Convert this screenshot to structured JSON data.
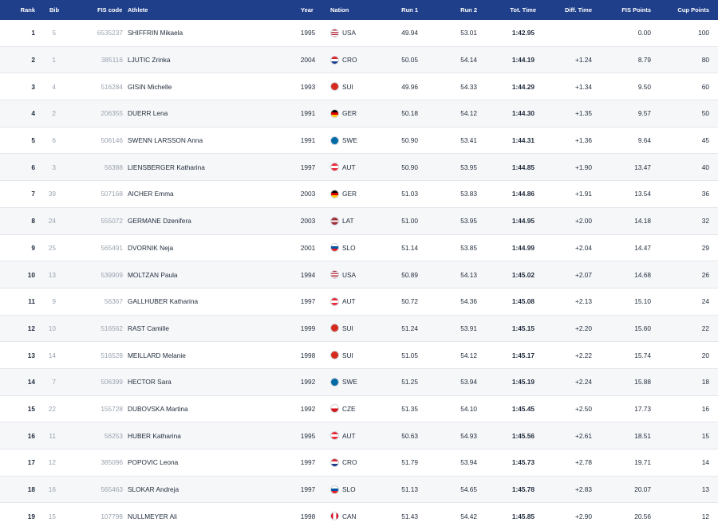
{
  "headers": {
    "rank": "Rank",
    "bib": "Bib",
    "fis_code": "FIS code",
    "athlete": "Athlete",
    "year": "Year",
    "nation": "Nation",
    "run1": "Run 1",
    "run2": "Run 2",
    "tot_time": "Tot. Time",
    "diff_time": "Diff. Time",
    "fis_points": "FIS Points",
    "cup_points": "Cup Points"
  },
  "rows": [
    {
      "rank": "1",
      "bib": "5",
      "fis_code": "6535237",
      "athlete": "SHIFFRIN Mikaela",
      "year": "1995",
      "nation": "USA",
      "flag": "flag-usa-icon",
      "run1": "49.94",
      "run2": "53.01",
      "tot_time": "1:42.95",
      "diff": "",
      "fis_points": "0.00",
      "cup_points": "100"
    },
    {
      "rank": "2",
      "bib": "1",
      "fis_code": "385116",
      "athlete": "LJUTIC Zrinka",
      "year": "2004",
      "nation": "CRO",
      "flag": "flag-cro-icon",
      "run1": "50.05",
      "run2": "54.14",
      "tot_time": "1:44.19",
      "diff": "+1.24",
      "fis_points": "8.79",
      "cup_points": "80"
    },
    {
      "rank": "3",
      "bib": "4",
      "fis_code": "516284",
      "athlete": "GISIN Michelle",
      "year": "1993",
      "nation": "SUI",
      "flag": "flag-sui-icon",
      "run1": "49.96",
      "run2": "54.33",
      "tot_time": "1:44.29",
      "diff": "+1.34",
      "fis_points": "9.50",
      "cup_points": "60"
    },
    {
      "rank": "4",
      "bib": "2",
      "fis_code": "206355",
      "athlete": "DUERR Lena",
      "year": "1991",
      "nation": "GER",
      "flag": "flag-ger-icon",
      "run1": "50.18",
      "run2": "54.12",
      "tot_time": "1:44.30",
      "diff": "+1.35",
      "fis_points": "9.57",
      "cup_points": "50"
    },
    {
      "rank": "5",
      "bib": "6",
      "fis_code": "506146",
      "athlete": "SWENN LARSSON Anna",
      "year": "1991",
      "nation": "SWE",
      "flag": "flag-swe-icon",
      "run1": "50.90",
      "run2": "53.41",
      "tot_time": "1:44.31",
      "diff": "+1.36",
      "fis_points": "9.64",
      "cup_points": "45"
    },
    {
      "rank": "6",
      "bib": "3",
      "fis_code": "56388",
      "athlete": "LIENSBERGER Katharina",
      "year": "1997",
      "nation": "AUT",
      "flag": "flag-aut-icon",
      "run1": "50.90",
      "run2": "53.95",
      "tot_time": "1:44.85",
      "diff": "+1.90",
      "fis_points": "13.47",
      "cup_points": "40"
    },
    {
      "rank": "7",
      "bib": "39",
      "fis_code": "507168",
      "athlete": "AICHER Emma",
      "year": "2003",
      "nation": "GER",
      "flag": "flag-ger-icon",
      "run1": "51.03",
      "run2": "53.83",
      "tot_time": "1:44.86",
      "diff": "+1.91",
      "fis_points": "13.54",
      "cup_points": "36"
    },
    {
      "rank": "8",
      "bib": "24",
      "fis_code": "555072",
      "athlete": "GERMANE Dzenifera",
      "year": "2003",
      "nation": "LAT",
      "flag": "flag-lat-icon",
      "run1": "51.00",
      "run2": "53.95",
      "tot_time": "1:44.95",
      "diff": "+2.00",
      "fis_points": "14.18",
      "cup_points": "32"
    },
    {
      "rank": "9",
      "bib": "25",
      "fis_code": "565491",
      "athlete": "DVORNIK Neja",
      "year": "2001",
      "nation": "SLO",
      "flag": "flag-slo-icon",
      "run1": "51.14",
      "run2": "53.85",
      "tot_time": "1:44.99",
      "diff": "+2.04",
      "fis_points": "14.47",
      "cup_points": "29"
    },
    {
      "rank": "10",
      "bib": "13",
      "fis_code": "539909",
      "athlete": "MOLTZAN Paula",
      "year": "1994",
      "nation": "USA",
      "flag": "flag-usa-icon",
      "run1": "50.89",
      "run2": "54.13",
      "tot_time": "1:45.02",
      "diff": "+2.07",
      "fis_points": "14.68",
      "cup_points": "26"
    },
    {
      "rank": "11",
      "bib": "9",
      "fis_code": "56367",
      "athlete": "GALLHUBER Katharina",
      "year": "1997",
      "nation": "AUT",
      "flag": "flag-aut-icon",
      "run1": "50.72",
      "run2": "54.36",
      "tot_time": "1:45.08",
      "diff": "+2.13",
      "fis_points": "15.10",
      "cup_points": "24"
    },
    {
      "rank": "12",
      "bib": "10",
      "fis_code": "516562",
      "athlete": "RAST Camille",
      "year": "1999",
      "nation": "SUI",
      "flag": "flag-sui-icon",
      "run1": "51.24",
      "run2": "53.91",
      "tot_time": "1:45.15",
      "diff": "+2.20",
      "fis_points": "15.60",
      "cup_points": "22"
    },
    {
      "rank": "13",
      "bib": "14",
      "fis_code": "516528",
      "athlete": "MEILLARD Melanie",
      "year": "1998",
      "nation": "SUI",
      "flag": "flag-sui-icon",
      "run1": "51.05",
      "run2": "54.12",
      "tot_time": "1:45.17",
      "diff": "+2.22",
      "fis_points": "15.74",
      "cup_points": "20"
    },
    {
      "rank": "14",
      "bib": "7",
      "fis_code": "506399",
      "athlete": "HECTOR Sara",
      "year": "1992",
      "nation": "SWE",
      "flag": "flag-swe-icon",
      "run1": "51.25",
      "run2": "53.94",
      "tot_time": "1:45.19",
      "diff": "+2.24",
      "fis_points": "15.88",
      "cup_points": "18"
    },
    {
      "rank": "15",
      "bib": "22",
      "fis_code": "155728",
      "athlete": "DUBOVSKA Martina",
      "year": "1992",
      "nation": "CZE",
      "flag": "flag-cze-icon",
      "run1": "51.35",
      "run2": "54.10",
      "tot_time": "1:45.45",
      "diff": "+2.50",
      "fis_points": "17.73",
      "cup_points": "16"
    },
    {
      "rank": "16",
      "bib": "11",
      "fis_code": "56253",
      "athlete": "HUBER Katharina",
      "year": "1995",
      "nation": "AUT",
      "flag": "flag-aut-icon",
      "run1": "50.63",
      "run2": "54.93",
      "tot_time": "1:45.56",
      "diff": "+2.61",
      "fis_points": "18.51",
      "cup_points": "15"
    },
    {
      "rank": "17",
      "bib": "12",
      "fis_code": "385096",
      "athlete": "POPOVIC Leona",
      "year": "1997",
      "nation": "CRO",
      "flag": "flag-cro-icon",
      "run1": "51.79",
      "run2": "53.94",
      "tot_time": "1:45.73",
      "diff": "+2.78",
      "fis_points": "19.71",
      "cup_points": "14"
    },
    {
      "rank": "18",
      "bib": "16",
      "fis_code": "565463",
      "athlete": "SLOKAR Andreja",
      "year": "1997",
      "nation": "SLO",
      "flag": "flag-slo-icon",
      "run1": "51.13",
      "run2": "54.65",
      "tot_time": "1:45.78",
      "diff": "+2.83",
      "fis_points": "20.07",
      "cup_points": "13"
    },
    {
      "rank": "19",
      "bib": "15",
      "fis_code": "107798",
      "athlete": "NULLMEYER Ali",
      "year": "1998",
      "nation": "CAN",
      "flag": "flag-can-icon",
      "run1": "51.43",
      "run2": "54.42",
      "tot_time": "1:45.85",
      "diff": "+2.90",
      "fis_points": "20.56",
      "cup_points": "12"
    }
  ]
}
